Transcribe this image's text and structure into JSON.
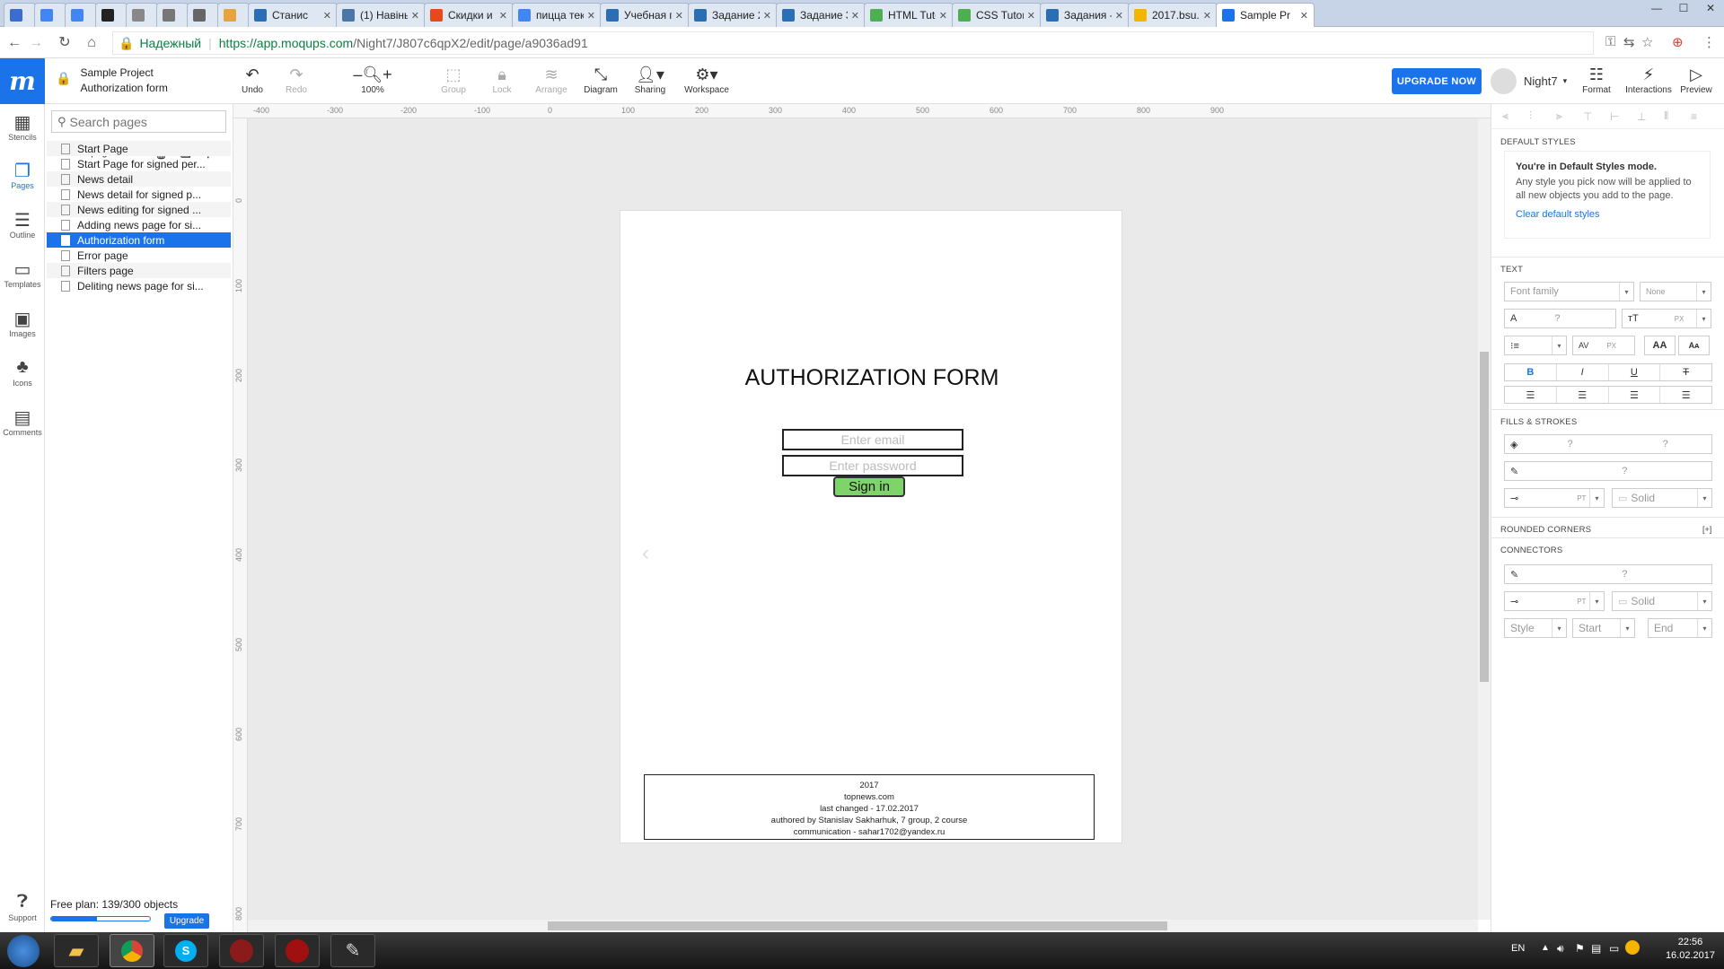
{
  "browser": {
    "tabs": [
      {
        "label": "",
        "color": "#3b6ccf"
      },
      {
        "label": "",
        "color": "#4285f4"
      },
      {
        "label": "",
        "color": "#4285f4"
      },
      {
        "label": "",
        "color": "#222222"
      },
      {
        "label": "",
        "color": "#888888"
      },
      {
        "label": "",
        "color": "#777777"
      },
      {
        "label": "",
        "color": "#666666"
      },
      {
        "label": "",
        "color": "#e8a33d"
      },
      {
        "label": "Станис",
        "color": "#2a6fb5"
      },
      {
        "label": "(1) Навіны",
        "color": "#4a76a8"
      },
      {
        "label": "Скидки и",
        "color": "#e64a19"
      },
      {
        "label": "пицца тек",
        "color": "#4285f4"
      },
      {
        "label": "Учебная п",
        "color": "#2a6fb5"
      },
      {
        "label": "Задание 2",
        "color": "#2a6fb5"
      },
      {
        "label": "Задание 3",
        "color": "#2a6fb5"
      },
      {
        "label": "HTML Tuto",
        "color": "#4caf50"
      },
      {
        "label": "CSS Tutori",
        "color": "#4caf50"
      },
      {
        "label": "Задания -",
        "color": "#2a6fb5"
      },
      {
        "label": "2017.bsu.b",
        "color": "#f4b400"
      },
      {
        "label": "Sample Pr",
        "color": "#1a73e8"
      }
    ],
    "secure_label": "Надежный",
    "url_host": "https://app.moqups.com",
    "url_path": "/Night7/J807c6qpX2/edit/page/a9036ad91"
  },
  "toolbar": {
    "logo": "m",
    "project_name": "Sample Project",
    "page_name": "Authorization form",
    "undo": "Undo",
    "redo": "Redo",
    "zoom": "100%",
    "group": "Group",
    "lock": "Lock",
    "arrange": "Arrange",
    "diagram": "Diagram",
    "sharing": "Sharing",
    "workspace": "Workspace",
    "upgrade_now": "UPGRADE NOW",
    "username": "Night7",
    "format": "Format",
    "interactions": "Interactions",
    "preview": "Preview"
  },
  "rail": {
    "stencils": "Stencils",
    "pages": "Pages",
    "outline": "Outline",
    "templates": "Templates",
    "images": "Images",
    "icons": "Icons",
    "comments": "Comments",
    "support": "Support"
  },
  "pages_panel": {
    "search_placeholder": "Search pages",
    "new_page": "New page",
    "pages": [
      "Start Page",
      "Start Page for signed per...",
      "News detail",
      "News detail for signed p...",
      "News editing for signed ...",
      "Adding news page for si...",
      "Authorization form",
      "Error page",
      "Filters page",
      "Deliting news page for si..."
    ],
    "selected_index": 6,
    "free_plan": "Free plan: 139/300 objects",
    "objects_used_fraction": 0.4633,
    "upgrade": "Upgrade"
  },
  "rulers": {
    "top": [
      "-400",
      "-300",
      "-200",
      "-100",
      "0",
      "100",
      "200",
      "300",
      "400",
      "500",
      "600",
      "700",
      "800",
      "900"
    ],
    "left": [
      "0",
      "100",
      "200",
      "300",
      "400",
      "500",
      "600",
      "700",
      "800"
    ]
  },
  "artboard": {
    "title": "AUTHORIZATION FORM",
    "email_placeholder": "Enter email",
    "password_placeholder": "Enter password",
    "signin": "Sign in",
    "footer": [
      "2017",
      "topnews.com",
      "last changed - 17.02.2017",
      "authored by Stanislav Sakharhuk, 7 group, 2 course",
      "communication - sahar1702@yandex.ru"
    ]
  },
  "right_panel": {
    "default_styles": "DEFAULT STYLES",
    "ds_heading": "You're in Default Styles mode.",
    "ds_text": "Any style you pick now will be applied to all new objects you add to the page.",
    "ds_link": "Clear default styles",
    "text_section": "TEXT",
    "font_family": "Font family",
    "none": "None",
    "q": "?",
    "px": "PX",
    "pt": "PT",
    "fills": "FILLS & STROKES",
    "solid": "Solid",
    "rounded": "ROUNDED CORNERS",
    "rounded_add": "[+]",
    "connectors": "CONNECTORS",
    "style": "Style",
    "start": "Start",
    "end": "End"
  },
  "taskbar": {
    "lang": "EN",
    "time": "22:56",
    "date": "16.02.2017"
  }
}
